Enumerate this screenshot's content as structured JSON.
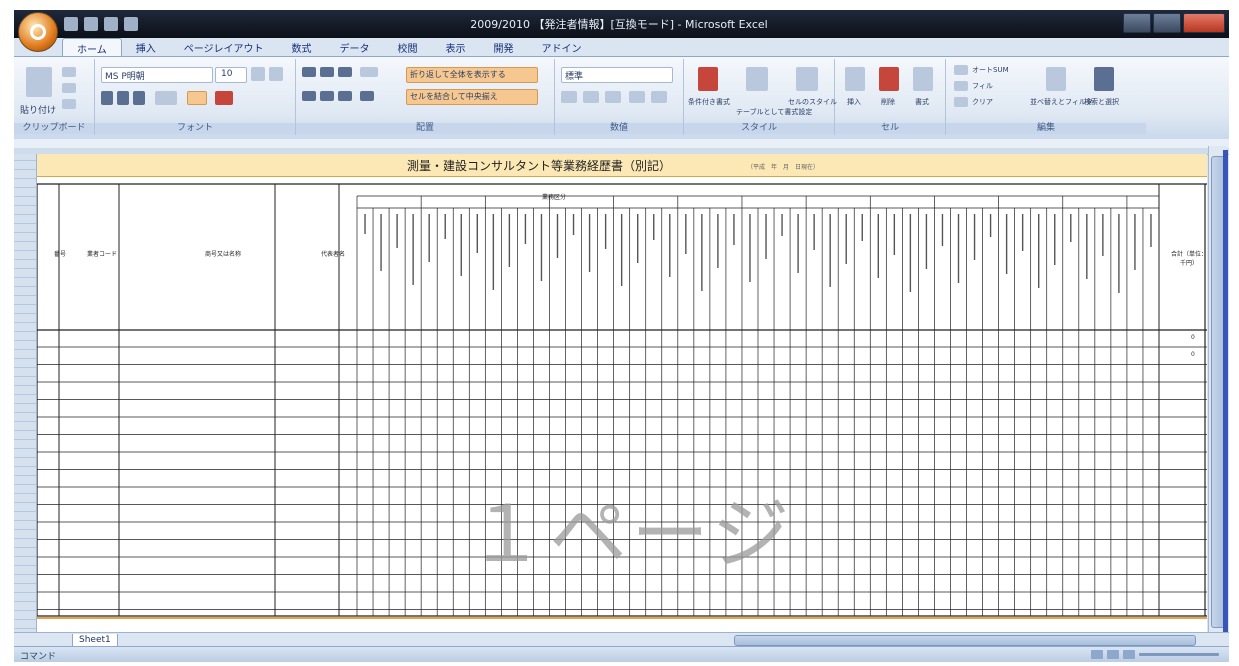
{
  "window": {
    "title": "2009/2010 【発注者情報】[互換モード] - Microsoft Excel"
  },
  "ribbon": {
    "tabs": [
      "ホーム",
      "挿入",
      "ページレイアウト",
      "数式",
      "データ",
      "校閲",
      "表示",
      "開発",
      "アドイン"
    ],
    "font_name": "MS P明朝",
    "font_size": "10",
    "number_format": "標準",
    "wrap_text": "折り返して全体を表示する",
    "merge_center": "セルを結合して中央揃え",
    "groups": {
      "clipboard": "クリップボード",
      "font": "フォント",
      "alignment": "配置",
      "number": "数値",
      "styles": "スタイル",
      "cells": "セル",
      "editing": "編集"
    },
    "buttons": {
      "paste": "貼り付け",
      "conditional": "条件付き書式",
      "table": "テーブルとして書式設定",
      "cell_style": "セルのスタイル",
      "insert": "挿入",
      "delete": "削除",
      "format": "書式",
      "autosum": "オートSUM",
      "fill": "フィル",
      "clear": "クリア",
      "sort": "並べ替えとフィルタ",
      "find": "検索と選択"
    }
  },
  "sheet": {
    "title": "測量・建設コンサルタント等業務経歴書（別記）",
    "subtitle": "（平成　年　月　日現在）",
    "headers": {
      "no": "番号",
      "code": "業者コード",
      "company": "商号又は名称",
      "rep": "代表者名",
      "right": "合計（単位：千円）"
    },
    "group_header": "業務区分",
    "right_values": [
      "0",
      "0"
    ],
    "watermark": "１ページ"
  },
  "status": {
    "ready": "コマンド",
    "sheet_tab": "Sheet1"
  }
}
